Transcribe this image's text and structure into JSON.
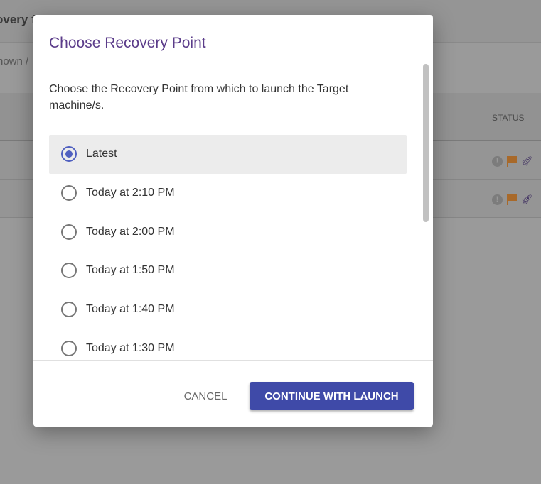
{
  "background": {
    "title_fragment": "overy f",
    "breadcrumb_fragment": "nown /",
    "status_header": "STATUS",
    "rows": [
      {
        "status_icons": [
          "exclamation-icon",
          "flag-icon",
          "rocket-icon"
        ]
      },
      {
        "status_icons": [
          "exclamation-icon",
          "flag-icon",
          "rocket-icon"
        ]
      }
    ]
  },
  "modal": {
    "title": "Choose Recovery Point",
    "description": "Choose the Recovery Point from which to launch the Target machine/s.",
    "options": [
      {
        "label": "Latest",
        "selected": true
      },
      {
        "label": "Today at 2:10 PM",
        "selected": false
      },
      {
        "label": "Today at 2:00 PM",
        "selected": false
      },
      {
        "label": "Today at 1:50 PM",
        "selected": false
      },
      {
        "label": "Today at 1:40 PM",
        "selected": false
      },
      {
        "label": "Today at 1:30 PM",
        "selected": false
      }
    ],
    "cancel_label": "CANCEL",
    "continue_label": "CONTINUE WITH LAUNCH",
    "colors": {
      "title": "#5b3c8a",
      "primary": "#3f4aa8",
      "radio": "#5060c0"
    }
  }
}
